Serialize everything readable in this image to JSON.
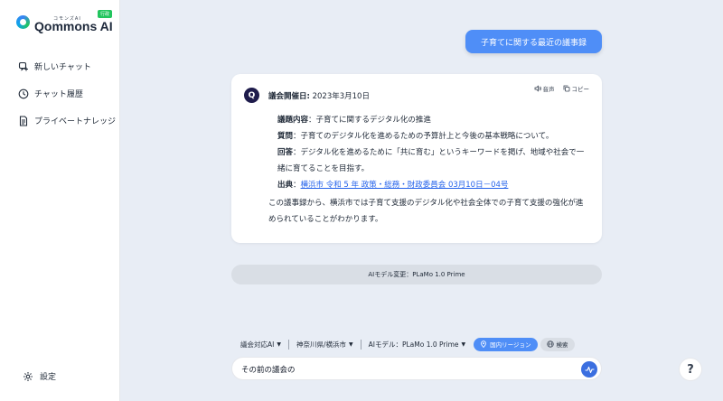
{
  "brand": {
    "name": "Qommons AI",
    "kana": "コモンズAI",
    "badge": "行政"
  },
  "sidebar": {
    "items": [
      {
        "label": "新しいチャット",
        "icon": "new-chat-icon"
      },
      {
        "label": "チャット履歴",
        "icon": "clock-icon"
      },
      {
        "label": "プライベートナレッジ",
        "icon": "document-icon"
      }
    ],
    "settings_label": "設定"
  },
  "chat": {
    "user_message": "子育てに関する最近の議事録",
    "answer": {
      "avatar_letter": "Q",
      "tools": {
        "voice": "音声",
        "copy": "コピー"
      },
      "date_label": "議会開催日:",
      "date_value": "2023年3月10日",
      "topic_label": "議題内容",
      "topic_value": "：子育てに関するデジタル化の推進",
      "question_label": "質問",
      "question_value": "：子育てのデジタル化を進めるための予算計上と今後の基本戦略について。",
      "answer_label": "回答",
      "answer_value": "：デジタル化を進めるために「共に育む」というキーワードを掲げ、地域や社会で一緒に育てることを目指す。",
      "source_label": "出典",
      "source_sep": "：",
      "source_link": "横浜市 令和 5 年 政策・総務・財政委員会 03月10日－04号",
      "summary": "この議事録から、横浜市では子育て支援のデジタル化や社会全体での子育て支援の強化が進められていることがわかります。"
    },
    "model_change_notice": "AIモデル変更：PLaMo 1.0 Prime"
  },
  "composer": {
    "selectors": [
      {
        "label": "議会対応AI"
      },
      {
        "label": "神奈川県/横浜市"
      },
      {
        "label": "AIモデル：PLaMo 1.0 Prime"
      }
    ],
    "region_pill": "国内リージョン",
    "search_pill": "検索",
    "input_value": "その前の議会の"
  },
  "help_label": "?",
  "colors": {
    "accent": "#4f8ef7",
    "link": "#2563eb",
    "avatar": "#1e1b4b"
  }
}
